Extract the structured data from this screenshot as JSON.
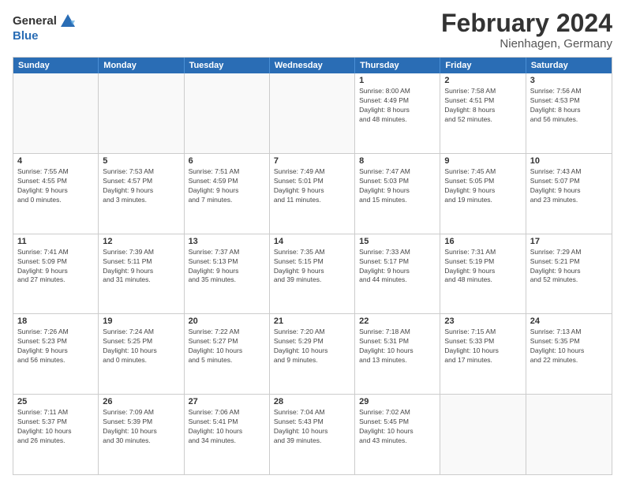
{
  "logo": {
    "general": "General",
    "blue": "Blue"
  },
  "header": {
    "title": "February 2024",
    "subtitle": "Nienhagen, Germany"
  },
  "days": [
    "Sunday",
    "Monday",
    "Tuesday",
    "Wednesday",
    "Thursday",
    "Friday",
    "Saturday"
  ],
  "weeks": [
    [
      {
        "day": "",
        "info": ""
      },
      {
        "day": "",
        "info": ""
      },
      {
        "day": "",
        "info": ""
      },
      {
        "day": "",
        "info": ""
      },
      {
        "day": "1",
        "info": "Sunrise: 8:00 AM\nSunset: 4:49 PM\nDaylight: 8 hours\nand 48 minutes."
      },
      {
        "day": "2",
        "info": "Sunrise: 7:58 AM\nSunset: 4:51 PM\nDaylight: 8 hours\nand 52 minutes."
      },
      {
        "day": "3",
        "info": "Sunrise: 7:56 AM\nSunset: 4:53 PM\nDaylight: 8 hours\nand 56 minutes."
      }
    ],
    [
      {
        "day": "4",
        "info": "Sunrise: 7:55 AM\nSunset: 4:55 PM\nDaylight: 9 hours\nand 0 minutes."
      },
      {
        "day": "5",
        "info": "Sunrise: 7:53 AM\nSunset: 4:57 PM\nDaylight: 9 hours\nand 3 minutes."
      },
      {
        "day": "6",
        "info": "Sunrise: 7:51 AM\nSunset: 4:59 PM\nDaylight: 9 hours\nand 7 minutes."
      },
      {
        "day": "7",
        "info": "Sunrise: 7:49 AM\nSunset: 5:01 PM\nDaylight: 9 hours\nand 11 minutes."
      },
      {
        "day": "8",
        "info": "Sunrise: 7:47 AM\nSunset: 5:03 PM\nDaylight: 9 hours\nand 15 minutes."
      },
      {
        "day": "9",
        "info": "Sunrise: 7:45 AM\nSunset: 5:05 PM\nDaylight: 9 hours\nand 19 minutes."
      },
      {
        "day": "10",
        "info": "Sunrise: 7:43 AM\nSunset: 5:07 PM\nDaylight: 9 hours\nand 23 minutes."
      }
    ],
    [
      {
        "day": "11",
        "info": "Sunrise: 7:41 AM\nSunset: 5:09 PM\nDaylight: 9 hours\nand 27 minutes."
      },
      {
        "day": "12",
        "info": "Sunrise: 7:39 AM\nSunset: 5:11 PM\nDaylight: 9 hours\nand 31 minutes."
      },
      {
        "day": "13",
        "info": "Sunrise: 7:37 AM\nSunset: 5:13 PM\nDaylight: 9 hours\nand 35 minutes."
      },
      {
        "day": "14",
        "info": "Sunrise: 7:35 AM\nSunset: 5:15 PM\nDaylight: 9 hours\nand 39 minutes."
      },
      {
        "day": "15",
        "info": "Sunrise: 7:33 AM\nSunset: 5:17 PM\nDaylight: 9 hours\nand 44 minutes."
      },
      {
        "day": "16",
        "info": "Sunrise: 7:31 AM\nSunset: 5:19 PM\nDaylight: 9 hours\nand 48 minutes."
      },
      {
        "day": "17",
        "info": "Sunrise: 7:29 AM\nSunset: 5:21 PM\nDaylight: 9 hours\nand 52 minutes."
      }
    ],
    [
      {
        "day": "18",
        "info": "Sunrise: 7:26 AM\nSunset: 5:23 PM\nDaylight: 9 hours\nand 56 minutes."
      },
      {
        "day": "19",
        "info": "Sunrise: 7:24 AM\nSunset: 5:25 PM\nDaylight: 10 hours\nand 0 minutes."
      },
      {
        "day": "20",
        "info": "Sunrise: 7:22 AM\nSunset: 5:27 PM\nDaylight: 10 hours\nand 5 minutes."
      },
      {
        "day": "21",
        "info": "Sunrise: 7:20 AM\nSunset: 5:29 PM\nDaylight: 10 hours\nand 9 minutes."
      },
      {
        "day": "22",
        "info": "Sunrise: 7:18 AM\nSunset: 5:31 PM\nDaylight: 10 hours\nand 13 minutes."
      },
      {
        "day": "23",
        "info": "Sunrise: 7:15 AM\nSunset: 5:33 PM\nDaylight: 10 hours\nand 17 minutes."
      },
      {
        "day": "24",
        "info": "Sunrise: 7:13 AM\nSunset: 5:35 PM\nDaylight: 10 hours\nand 22 minutes."
      }
    ],
    [
      {
        "day": "25",
        "info": "Sunrise: 7:11 AM\nSunset: 5:37 PM\nDaylight: 10 hours\nand 26 minutes."
      },
      {
        "day": "26",
        "info": "Sunrise: 7:09 AM\nSunset: 5:39 PM\nDaylight: 10 hours\nand 30 minutes."
      },
      {
        "day": "27",
        "info": "Sunrise: 7:06 AM\nSunset: 5:41 PM\nDaylight: 10 hours\nand 34 minutes."
      },
      {
        "day": "28",
        "info": "Sunrise: 7:04 AM\nSunset: 5:43 PM\nDaylight: 10 hours\nand 39 minutes."
      },
      {
        "day": "29",
        "info": "Sunrise: 7:02 AM\nSunset: 5:45 PM\nDaylight: 10 hours\nand 43 minutes."
      },
      {
        "day": "",
        "info": ""
      },
      {
        "day": "",
        "info": ""
      }
    ]
  ]
}
